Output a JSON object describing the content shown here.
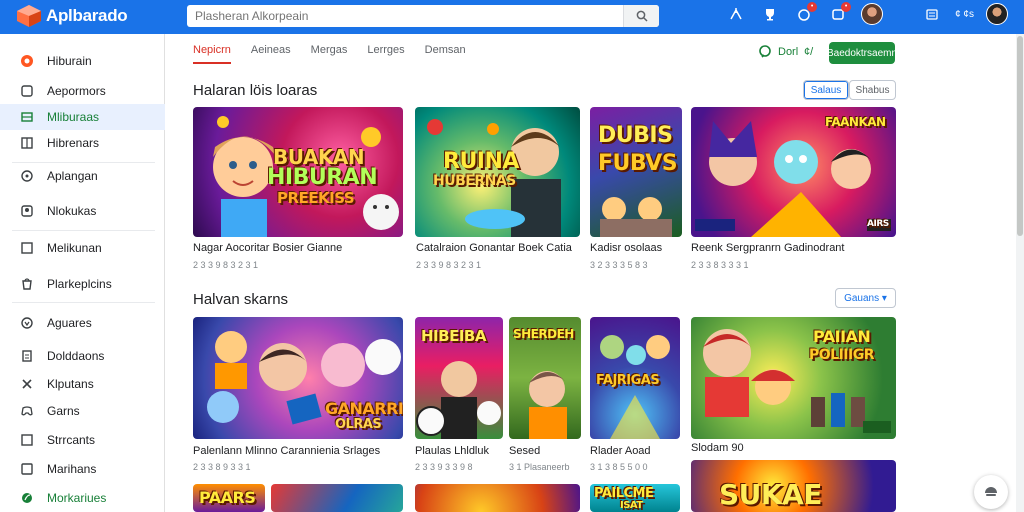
{
  "app": {
    "title": "Aplbarado"
  },
  "search": {
    "placeholder": "Plasheran Alkorpeain"
  },
  "header": {
    "coin_text": "¢ ¢s"
  },
  "sidebar": {
    "items": [
      {
        "label": "Hiburain",
        "icon": "brand-circle-icon"
      },
      {
        "label": "Aepormors",
        "icon": "square-icon"
      },
      {
        "label": "Mliburaas",
        "icon": "list-icon"
      },
      {
        "label": "Hibrenars",
        "icon": "grid-icon"
      },
      {
        "label": "Aplangan",
        "icon": "circle-icon"
      },
      {
        "label": "Nlokukas",
        "icon": "person-icon"
      },
      {
        "label": "Melikunan",
        "icon": "square-icon"
      },
      {
        "label": "Plarkeplcins",
        "icon": "shopping-icon"
      },
      {
        "label": "Aguares",
        "icon": "shield-icon"
      },
      {
        "label": "Dolddaons",
        "icon": "doc-icon"
      },
      {
        "label": "Klputans",
        "icon": "cross-icon"
      },
      {
        "label": "Garns",
        "icon": "gamepad-icon"
      },
      {
        "label": "Strrcants",
        "icon": "square-icon"
      },
      {
        "label": "Marihans",
        "icon": "square-icon"
      },
      {
        "label": "Morkariues",
        "icon": "leaf-icon"
      }
    ]
  },
  "tabs": [
    "Nepicrn",
    "Aeineas",
    "Mergas",
    "Lerrges",
    "Demsan"
  ],
  "toolbar": {
    "chip_label": "Dorl",
    "chip_count": "¢/",
    "green_button": "Baedoktrsaemn"
  },
  "sections": [
    {
      "title": "Halaran löis loaras",
      "pills": [
        "Salaus",
        "Shabus"
      ],
      "cards": [
        {
          "title": "Nagar Aocoritar Bosier Gianne",
          "meta": "2 3 3 9 8 3 2 3 1",
          "art": [
            "BUAKAN",
            "HIBURAN",
            "PREEKISS"
          ]
        },
        {
          "title": "Catalraion Gonantar Boek Catia",
          "meta": "2 3 3 9 8 3 2 3 1",
          "art": [
            "RUINA",
            "HUBERNAS"
          ]
        },
        {
          "title": "Kadisr osolaas",
          "meta": "3 2 3 3 3 5 8 3",
          "art": [
            "DUBIS",
            "FUBVS"
          ]
        },
        {
          "title": "Reenk Sergpranrn Gadinodrant",
          "meta": "2 3 3 8 3 3 3 1",
          "art": [
            "FAANKAN",
            "AIRS"
          ]
        }
      ]
    },
    {
      "title": "Halvan skarns",
      "pills": [
        "Gauans ▾"
      ],
      "cards": [
        {
          "title": "Palenlann Mlinno Carannienia Srlages",
          "meta": "2 3 3 8 9 3 3 1",
          "art": [
            "GANARRI",
            "OLRAS"
          ]
        },
        {
          "title": "Plaulas Lhldluk",
          "meta": "2 3 3 9 3 3 9 8",
          "art": [
            "HIBEIBA"
          ]
        },
        {
          "title": "Sesed",
          "meta": "3 1 Plasaneerb",
          "art": [
            "SHERDEH"
          ]
        },
        {
          "title": "Rlader Aoad",
          "meta": "3 1 3 8 5 5 0 0",
          "art": [
            "FAJRIGAS"
          ]
        },
        {
          "title": "Slodam 90",
          "meta": "",
          "art": [
            "PAIIAN",
            "POLIIIGR"
          ]
        }
      ]
    },
    {
      "cards": [
        {
          "art": [
            "PAARS"
          ]
        },
        {
          "art": []
        },
        {
          "art": []
        },
        {
          "art": [
            "PAILCME",
            "ISAT"
          ]
        },
        {
          "art": [
            "SUKAE"
          ]
        }
      ]
    }
  ],
  "colors": {
    "topbar": "#1a73e8",
    "active_green": "#188038",
    "tab_red": "#d93025"
  }
}
